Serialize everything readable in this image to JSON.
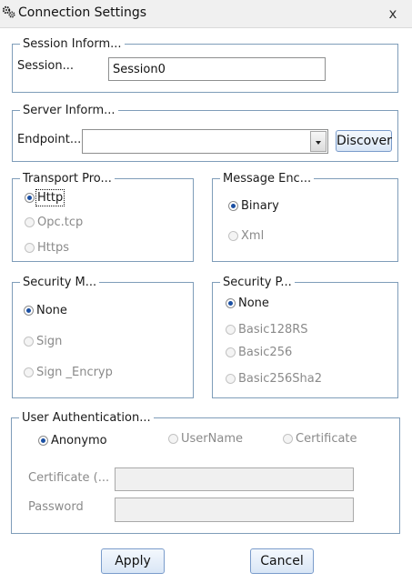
{
  "window": {
    "title": "Connection Settings",
    "close_label": "x",
    "icon": "gears-icon"
  },
  "session": {
    "legend": "Session Inform...",
    "label": "Session...",
    "value": "Session0"
  },
  "server": {
    "legend": "Server Inform...",
    "endpoint_label": "Endpoint...",
    "endpoint_value": "",
    "discover_label": "Discover"
  },
  "transport": {
    "legend": "Transport Pro...",
    "options": [
      {
        "label": "Http",
        "checked": true,
        "enabled": true
      },
      {
        "label": "Opc.tcp",
        "checked": false,
        "enabled": false
      },
      {
        "label": "Https",
        "checked": false,
        "enabled": false
      }
    ]
  },
  "encoding": {
    "legend": "Message Enc...",
    "options": [
      {
        "label": "Binary",
        "checked": true,
        "enabled": true
      },
      {
        "label": "Xml",
        "checked": false,
        "enabled": false
      }
    ]
  },
  "security_mode": {
    "legend": "Security M...",
    "options": [
      {
        "label": "None",
        "checked": true,
        "enabled": true
      },
      {
        "label": "Sign",
        "checked": false,
        "enabled": false
      },
      {
        "label": "Sign _Encryp",
        "checked": false,
        "enabled": false
      }
    ]
  },
  "security_policy": {
    "legend": "Security P...",
    "options": [
      {
        "label": "None",
        "checked": true,
        "enabled": true
      },
      {
        "label": "Basic128RS",
        "checked": false,
        "enabled": false
      },
      {
        "label": "Basic256",
        "checked": false,
        "enabled": false
      },
      {
        "label": "Basic256Sha2",
        "checked": false,
        "enabled": false
      }
    ]
  },
  "auth": {
    "legend": "User Authentication...",
    "options": [
      {
        "label": "Anonymo",
        "checked": true,
        "enabled": true
      },
      {
        "label": "UserName",
        "checked": false,
        "enabled": false
      },
      {
        "label": "Certificate",
        "checked": false,
        "enabled": false
      }
    ],
    "certificate_label": "Certificate (...",
    "certificate_value": "",
    "password_label": "Password",
    "password_value": ""
  },
  "footer": {
    "apply_label": "Apply",
    "cancel_label": "Cancel"
  }
}
